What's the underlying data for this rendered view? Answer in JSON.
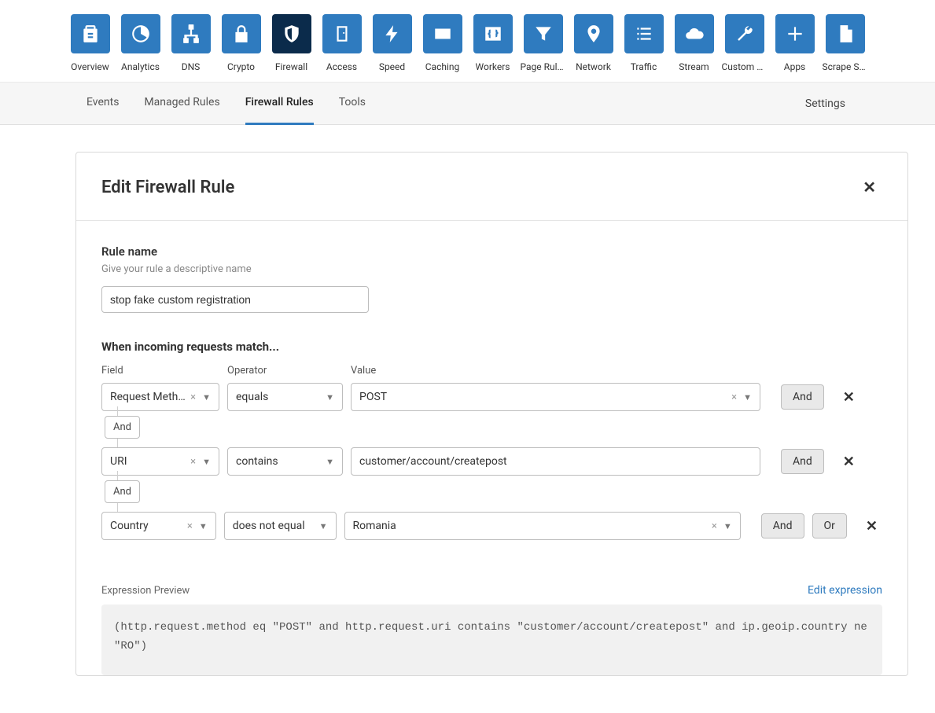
{
  "topnav": [
    {
      "label": "Overview",
      "icon": "clipboard",
      "active": false
    },
    {
      "label": "Analytics",
      "icon": "pie",
      "active": false
    },
    {
      "label": "DNS",
      "icon": "sitemap",
      "active": false
    },
    {
      "label": "Crypto",
      "icon": "lock",
      "active": false
    },
    {
      "label": "Firewall",
      "icon": "shield",
      "active": true
    },
    {
      "label": "Access",
      "icon": "door",
      "active": false
    },
    {
      "label": "Speed",
      "icon": "bolt",
      "active": false
    },
    {
      "label": "Caching",
      "icon": "card",
      "active": false
    },
    {
      "label": "Workers",
      "icon": "braces",
      "active": false
    },
    {
      "label": "Page Rules",
      "icon": "funnel",
      "active": false
    },
    {
      "label": "Network",
      "icon": "pin",
      "active": false
    },
    {
      "label": "Traffic",
      "icon": "list",
      "active": false
    },
    {
      "label": "Stream",
      "icon": "cloud",
      "active": false
    },
    {
      "label": "Custom P...",
      "icon": "wrench",
      "active": false
    },
    {
      "label": "Apps",
      "icon": "plus",
      "active": false
    },
    {
      "label": "Scrape Shi...",
      "icon": "file",
      "active": false
    }
  ],
  "subnav": {
    "tabs": [
      {
        "label": "Events",
        "active": false
      },
      {
        "label": "Managed Rules",
        "active": false
      },
      {
        "label": "Firewall Rules",
        "active": true
      },
      {
        "label": "Tools",
        "active": false
      }
    ],
    "settings": "Settings"
  },
  "card": {
    "title": "Edit Firewall Rule",
    "rule_name_label": "Rule name",
    "rule_name_help": "Give your rule a descriptive name",
    "rule_name_value": "stop fake custom registration",
    "match_title": "When incoming requests match...",
    "col_field": "Field",
    "col_operator": "Operator",
    "col_value": "Value",
    "rows": [
      {
        "field": "Request Meth...",
        "operator": "equals",
        "value": "POST",
        "value_clear": true,
        "show_or": false,
        "connector": "And"
      },
      {
        "field": "URI",
        "operator": "contains",
        "value": "customer/account/createpost",
        "value_clear": false,
        "show_or": false,
        "connector": "And"
      },
      {
        "field": "Country",
        "operator": "does not equal",
        "value": "Romania",
        "value_clear": true,
        "show_or": true,
        "connector": null
      }
    ],
    "and_label": "And",
    "or_label": "Or",
    "expr_label": "Expression Preview",
    "expr_edit": "Edit expression",
    "expression": "(http.request.method eq \"POST\" and http.request.uri contains \"customer/account/createpost\" and ip.geoip.country ne \"RO\")"
  }
}
